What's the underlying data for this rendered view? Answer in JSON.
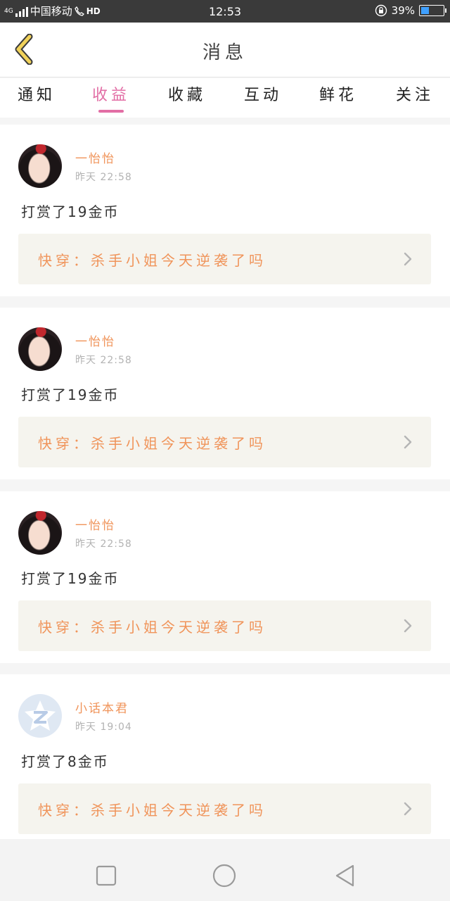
{
  "status_bar": {
    "network_tag": "4G",
    "carrier": "中国移动",
    "hd_label": "HD",
    "time": "12:53",
    "battery_percent": "39%",
    "battery_level": 0.39
  },
  "header": {
    "title": "消息"
  },
  "tabs": [
    {
      "label": "通知"
    },
    {
      "label": "收益",
      "active": true
    },
    {
      "label": "收藏"
    },
    {
      "label": "互动"
    },
    {
      "label": "鲜花"
    },
    {
      "label": "关注"
    }
  ],
  "messages": [
    {
      "user": "一怡怡",
      "time": "昨天 22:58",
      "action": "打赏了19金币",
      "book": "快穿：杀手小姐今天逆袭了吗",
      "avatar": "photo"
    },
    {
      "user": "一怡怡",
      "time": "昨天 22:58",
      "action": "打赏了19金币",
      "book": "快穿：杀手小姐今天逆袭了吗",
      "avatar": "photo"
    },
    {
      "user": "一怡怡",
      "time": "昨天 22:58",
      "action": "打赏了19金币",
      "book": "快穿：杀手小姐今天逆袭了吗",
      "avatar": "photo"
    },
    {
      "user": "小话本君",
      "time": "昨天 19:04",
      "action": "打赏了8金币",
      "book": "快穿：杀手小姐今天逆袭了吗",
      "avatar": "logo"
    }
  ],
  "icons": {
    "back": "chevron-left-icon",
    "row_arrow": "chevron-right-icon",
    "nav": [
      "square-icon",
      "circle-icon",
      "triangle-back-icon"
    ]
  },
  "colors": {
    "accent": "#e26ea5",
    "orange_text": "#f0945a",
    "back_arrow": "#f1d25a",
    "card_link_bg": "#f5f4ee"
  }
}
